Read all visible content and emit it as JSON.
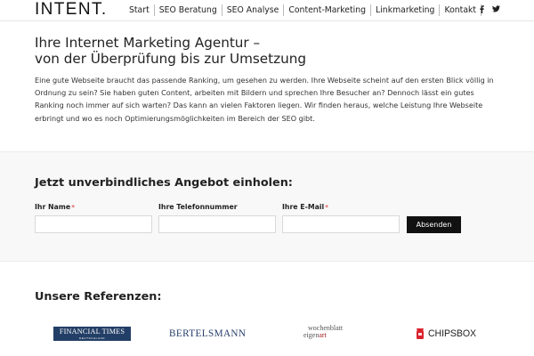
{
  "header": {
    "logo": "INTENT.",
    "nav": [
      {
        "label": "Start"
      },
      {
        "label": "SEO Beratung"
      },
      {
        "label": "SEO Analyse"
      },
      {
        "label": "Content-Marketing"
      },
      {
        "label": "Linkmarketing"
      },
      {
        "label": "Kontakt"
      }
    ],
    "social": [
      {
        "icon": "facebook-icon"
      },
      {
        "icon": "twitter-icon"
      }
    ]
  },
  "intro": {
    "headline_line1": "Ihre Internet Marketing Agentur –",
    "headline_line2": "von der Überprüfung bis zur Umsetzung",
    "text": "Eine gute Webseite braucht das passende Ranking, um gesehen zu werden. Ihre Webseite scheint auf den ersten Blick völlig in Ordnung zu sein? Sie haben guten Content, arbeiten mit Bildern und sprechen Ihre Besucher an? Dennoch lässt ein gutes Ranking noch immer auf sich warten? Das kann an vielen Faktoren liegen. Wir finden heraus, welche Leistung Ihre Webseite erbringt und wo es noch Optimierungsmöglichkeiten im Bereich der SEO gibt."
  },
  "form": {
    "title": "Jetzt unverbindliches Angebot einholen:",
    "fields": [
      {
        "label": "Ihr Name",
        "required_mark": "*",
        "value": "",
        "placeholder": ""
      },
      {
        "label": "Ihre Telefonnummer",
        "required_mark": "",
        "value": "",
        "placeholder": ""
      },
      {
        "label": "Ihre E-Mail",
        "required_mark": "*",
        "value": "",
        "placeholder": ""
      }
    ],
    "submit_label": "Absenden",
    "required_color": "#d9534f"
  },
  "references": {
    "title": "Unsere Referenzen:",
    "logos": {
      "ft_main": "FINANCIAL TIMES",
      "ft_sub": "DEUTSCHLAND",
      "bertelsmann": "BERTELSMANN",
      "wochenblatt_top": "wochenblatt",
      "wochenblatt_bottom_a": "eigen",
      "wochenblatt_bottom_b": "art",
      "chipsbox": "CHIPSBOX"
    }
  },
  "colors": {
    "accent_dark": "#111111",
    "ft_blue": "#233f67",
    "bertelsmann_blue": "#243d6a",
    "chipsbox_red": "#d9232e"
  }
}
